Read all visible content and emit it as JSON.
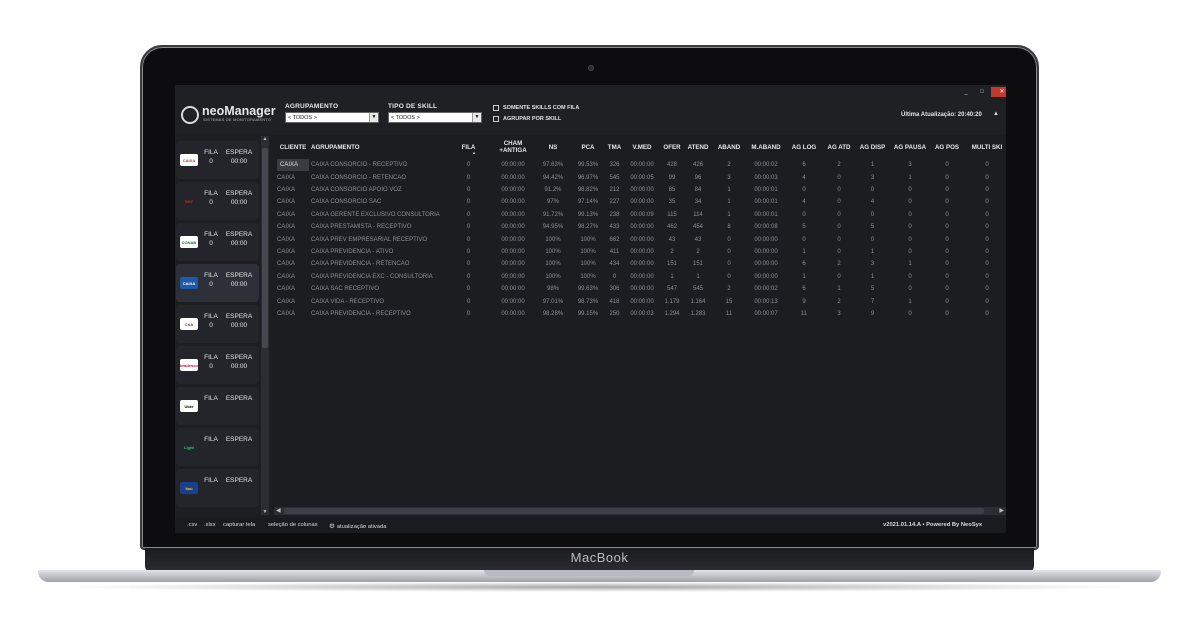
{
  "device": {
    "brand": "MacBook"
  },
  "app": {
    "logo_text": "neoManager",
    "logo_sub": "SISTEMAS DE MONITORAMENTO",
    "window_controls": {
      "minimize": "_",
      "restore": "□",
      "close": "✕"
    }
  },
  "filters": {
    "agrupamento": {
      "label": "AGRUPAMENTO",
      "value": "< TODOS >"
    },
    "tipo_skill": {
      "label": "TIPO DE SKILL",
      "value": "< TODOS >"
    },
    "somente_skills_com_fila": {
      "label": "SOMENTE SKILLS COM FILA",
      "checked": false
    },
    "agrupar_por_skill": {
      "label": "AGRUPAR POR SKILL",
      "checked": false
    }
  },
  "last_update": "Última Atualização: 20:40:20",
  "sidebar": {
    "col_fila": "FILA",
    "col_espera": "ESPERA",
    "clients": [
      {
        "name": "CAIXA",
        "logo_text": "CAIXA",
        "fila": "0",
        "espera": "00:00",
        "logo_bg": "#ffffff",
        "logo_fg": "#c0392b",
        "active": false
      },
      {
        "name": "SKY",
        "logo_text": "SKY",
        "fila": "0",
        "espera": "00:00",
        "logo_bg": "#23252b",
        "logo_fg": "#e02020",
        "active": false
      },
      {
        "name": "CONAB",
        "logo_text": "CONAB",
        "fila": "0",
        "espera": "00:00",
        "logo_bg": "#ffffff",
        "logo_fg": "#1d6b3a",
        "active": false
      },
      {
        "name": "CAIXA-BLUE",
        "logo_text": "CAIXA",
        "fila": "0",
        "espera": "00:00",
        "logo_bg": "#1e5aa8",
        "logo_fg": "#ffffff",
        "active": true
      },
      {
        "name": "C&A",
        "logo_text": "C&A",
        "fila": "0",
        "espera": "00:00",
        "logo_bg": "#ffffff",
        "logo_fg": "#d01f2e",
        "active": false
      },
      {
        "name": "BRADESCO",
        "logo_text": "bradesco",
        "fila": "0",
        "espera": "00:00",
        "logo_bg": "#ffffff",
        "logo_fg": "#cc092f",
        "active": false
      },
      {
        "name": "UBER",
        "logo_text": "Uber",
        "fila": "",
        "espera": "",
        "logo_bg": "#ffffff",
        "logo_fg": "#000000",
        "active": false
      },
      {
        "name": "LIGHT",
        "logo_text": "Light",
        "fila": "",
        "espera": "",
        "logo_bg": "#23252b",
        "logo_fg": "#2ecc71",
        "active": false
      },
      {
        "name": "ITAU",
        "logo_text": "Itaú",
        "fila": "",
        "espera": "",
        "logo_bg": "#1b3f8f",
        "logo_fg": "#f5c400",
        "active": false
      }
    ]
  },
  "table": {
    "columns": [
      "CLIENTE",
      "AGRUPAMENTO",
      "FILA",
      "CHAM\n+ANTIGA",
      "NS",
      "PCA",
      "TMA",
      "V.MED",
      "OFER",
      "ATEND",
      "ABAND",
      "M.ABAND",
      "AG LOG",
      "AG ATD",
      "AG DISP",
      "AG PAUSA",
      "AG POS",
      "MULTI SKI"
    ],
    "rows": [
      [
        "CAIXA",
        "CAIXA CONSORCIO - RECEPTIVO",
        "0",
        "00:00:00",
        "97.63%",
        "99.53%",
        "326",
        "00:00:00",
        "428",
        "426",
        "2",
        "00:00:02",
        "6",
        "2",
        "1",
        "3",
        "0",
        "0"
      ],
      [
        "CAIXA",
        "CAIXA CONSORCIO - RETENCAO",
        "0",
        "00:00:00",
        "94.42%",
        "96.97%",
        "545",
        "00:00:05",
        "99",
        "96",
        "3",
        "00:00:03",
        "4",
        "0",
        "3",
        "1",
        "0",
        "0"
      ],
      [
        "CAIXA",
        "CAIXA CONSORCIO APOIO VOZ",
        "0",
        "00:00:00",
        "91.2%",
        "98.82%",
        "212",
        "00:00:00",
        "85",
        "84",
        "1",
        "00:00:01",
        "0",
        "0",
        "0",
        "0",
        "0",
        "0"
      ],
      [
        "CAIXA",
        "CAIXA CONSORCIO SAC",
        "0",
        "00:00:00",
        "97%",
        "97.14%",
        "227",
        "00:00:00",
        "35",
        "34",
        "1",
        "00:00:01",
        "4",
        "0",
        "4",
        "0",
        "0",
        "0"
      ],
      [
        "CAIXA",
        "CAIXA GERENTE EXCLUSIVO CONSULTORIA",
        "0",
        "00:00:00",
        "91.72%",
        "99.13%",
        "238",
        "00:00:09",
        "115",
        "114",
        "1",
        "00:00:01",
        "0",
        "0",
        "0",
        "0",
        "0",
        "0"
      ],
      [
        "CAIXA",
        "CAIXA PRESTAMISTA - RECEPTIVO",
        "0",
        "00:00:00",
        "94.95%",
        "98.27%",
        "433",
        "00:00:00",
        "462",
        "454",
        "8",
        "00:00:08",
        "5",
        "0",
        "5",
        "0",
        "0",
        "0"
      ],
      [
        "CAIXA",
        "CAIXA PREV EMPRESARIAL RECEPTIVO",
        "0",
        "00:00:00",
        "100%",
        "100%",
        "662",
        "00:00:00",
        "43",
        "43",
        "0",
        "00:00:00",
        "0",
        "0",
        "0",
        "0",
        "0",
        "0"
      ],
      [
        "CAIXA",
        "CAIXA PREVIDENCIA - ATIVO",
        "0",
        "00:00:00",
        "100%",
        "100%",
        "411",
        "00:00:00",
        "2",
        "2",
        "0",
        "00:00:00",
        "1",
        "0",
        "1",
        "0",
        "0",
        "0"
      ],
      [
        "CAIXA",
        "CAIXA PREVIDENCIA - RETENCAO",
        "0",
        "00:00:00",
        "100%",
        "100%",
        "434",
        "00:00:00",
        "151",
        "151",
        "0",
        "00:00:00",
        "6",
        "2",
        "3",
        "1",
        "0",
        "0"
      ],
      [
        "CAIXA",
        "CAIXA PREVIDENCIA EXC - CONSULTORIA",
        "0",
        "00:00:00",
        "100%",
        "100%",
        "0",
        "00:00:00",
        "1",
        "1",
        "0",
        "00:00:00",
        "1",
        "0",
        "1",
        "0",
        "0",
        "0"
      ],
      [
        "CAIXA",
        "CAIXA SAC RECEPTIVO",
        "0",
        "00:00:00",
        "98%",
        "99.63%",
        "306",
        "00:00:00",
        "547",
        "545",
        "2",
        "00:00:02",
        "6",
        "1",
        "5",
        "0",
        "0",
        "0"
      ],
      [
        "CAIXA",
        "CAIXA VIDA - RECEPTIVO",
        "0",
        "00:00:00",
        "97.01%",
        "98.73%",
        "418",
        "00:00:00",
        "1.179",
        "1.164",
        "15",
        "00:00:13",
        "9",
        "2",
        "7",
        "1",
        "0",
        "0"
      ],
      [
        "CAIXA",
        "CAIXA PREVIDENCIA - RECEPTIVO",
        "0",
        "00:00:00",
        "98.28%",
        "99.15%",
        "250",
        "00:00:03",
        "1.294",
        "1.283",
        "11",
        "00:00:07",
        "11",
        "3",
        "9",
        "0",
        "0",
        "0"
      ]
    ]
  },
  "footer": {
    "csv": ".csv",
    "xlsx": ".xlsx",
    "capturar": "capturar tela",
    "selecao": "seleção de colunas",
    "atualizacao": "atualização ativada",
    "version": "v2021.01.14.A • Powered By NeoSyx"
  }
}
